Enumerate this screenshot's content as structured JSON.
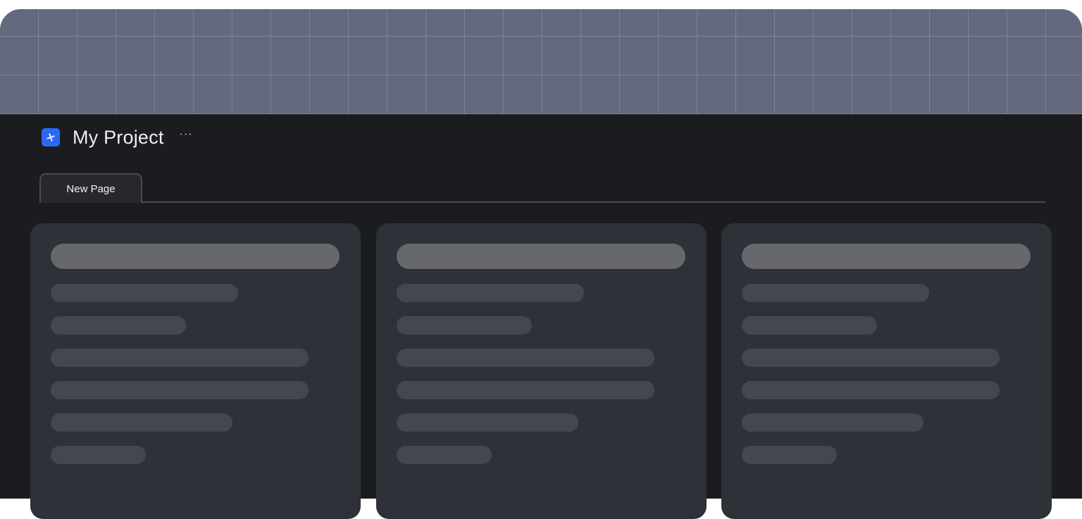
{
  "project": {
    "title": "My Project",
    "more_label": "···",
    "logo_icon": "project-logo-icon",
    "accent_color": "#2b68f5"
  },
  "tabs": [
    {
      "label": "New Page",
      "active": true
    }
  ],
  "cards": [
    {
      "placeholder": "skeleton"
    },
    {
      "placeholder": "skeleton"
    },
    {
      "placeholder": "skeleton"
    }
  ]
}
